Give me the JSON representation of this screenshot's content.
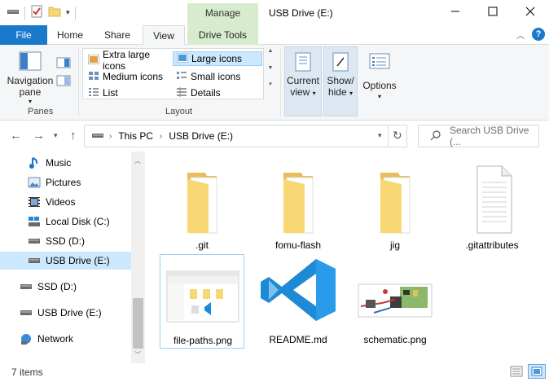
{
  "window": {
    "context_tab": "Manage",
    "title": "USB Drive (E:)"
  },
  "ribbon_tabs": {
    "file": "File",
    "home": "Home",
    "share": "Share",
    "view": "View",
    "drive_tools": "Drive Tools"
  },
  "ribbon": {
    "navigation_pane": [
      "Navigation",
      "pane"
    ],
    "panes_label": "Panes",
    "layout_label": "Layout",
    "layout_items": {
      "extra_large": "Extra large icons",
      "large": "Large icons",
      "medium": "Medium icons",
      "small": "Small icons",
      "list": "List",
      "details": "Details"
    },
    "current_view": [
      "Current",
      "view"
    ],
    "show_hide": [
      "Show/",
      "hide"
    ],
    "options": "Options"
  },
  "address": {
    "crumbs": [
      "This PC",
      "USB Drive (E:)"
    ],
    "search_placeholder": "Search USB Drive (..."
  },
  "nav": {
    "items": [
      {
        "label": "Music",
        "icon": "music-icon"
      },
      {
        "label": "Pictures",
        "icon": "pictures-icon"
      },
      {
        "label": "Videos",
        "icon": "videos-icon"
      },
      {
        "label": "Local Disk (C:)",
        "icon": "local-disk-icon"
      },
      {
        "label": "SSD (D:)",
        "icon": "drive-icon"
      },
      {
        "label": "USB Drive (E:)",
        "icon": "drive-icon"
      },
      {
        "label": "SSD (D:)",
        "icon": "drive-icon"
      },
      {
        "label": "USB Drive (E:)",
        "icon": "drive-icon"
      },
      {
        "label": "Network",
        "icon": "network-icon"
      }
    ]
  },
  "files": [
    {
      "name": ".git",
      "type": "folder-icon"
    },
    {
      "name": "fomu-flash",
      "type": "folder-icon"
    },
    {
      "name": "jig",
      "type": "folder-icon"
    },
    {
      "name": ".gitattributes",
      "type": "document-icon"
    },
    {
      "name": "file-paths.png",
      "type": "image-thumbnail-icon"
    },
    {
      "name": "README.md",
      "type": "vscode-icon"
    },
    {
      "name": "schematic.png",
      "type": "image-thumbnail-icon"
    }
  ],
  "status": {
    "item_count": "7 items"
  },
  "colors": {
    "file_tab": "#1979ca",
    "manage_context": "#d7eccd",
    "selection": "#cce8ff",
    "folder": "#f8d775",
    "vscode_blue": "#1e8ad6"
  }
}
